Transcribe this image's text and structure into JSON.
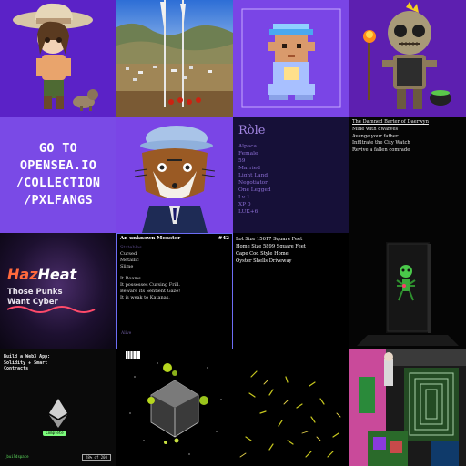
{
  "tiles": {
    "t5": {
      "lines": [
        "GO TO",
        "OPENSEA.IO",
        "/COLLECTION",
        "/PXLFANGS"
      ]
    },
    "t7": {
      "title": "Ròle",
      "lines": [
        "Alpaca",
        "Female",
        "59",
        "Married",
        "Light Land",
        "Negotiator",
        "One Legged",
        "Lv 1",
        "XP 0",
        "LUK+6"
      ]
    },
    "t8": {
      "lines": [
        "The Damned Barter of Daerwyn",
        "Mine with dwarves",
        "Avenge your father",
        "Infiltrate the City Watch",
        "Revive a fallen comrade"
      ]
    },
    "t9": {
      "title_h": "Haz",
      "title_rest": "Heat",
      "sub1": "Those Punks",
      "sub2": "Want Cyber"
    },
    "t10": {
      "title": "An unknown Monster",
      "number": "#42",
      "faint": "Stateblas",
      "attrs": [
        "Cursed",
        "Metallic",
        "Slime"
      ],
      "desc": [
        "It Roams.",
        "It possesses Cursing Frill.",
        "Beware its Sentient Gaze!",
        "It is weak to Katanas."
      ],
      "foot": "Alive"
    },
    "t11": {
      "lines": [
        "Lot Size 15617 Square Feet",
        "Home Size 5899 Square Feet",
        "Cape Cod Style Home",
        "Oyster Shells Driveway"
      ]
    },
    "t13": {
      "lines": [
        "Build a Web3 App:",
        "Solidity + Smart",
        "Contracts"
      ],
      "pill": "Complete",
      "lower_left": "_buildspace",
      "lower_right": "28% of 200"
    }
  },
  "colors": {
    "purple": "#7a4ae6",
    "accent_blue": "#6d6df5"
  }
}
